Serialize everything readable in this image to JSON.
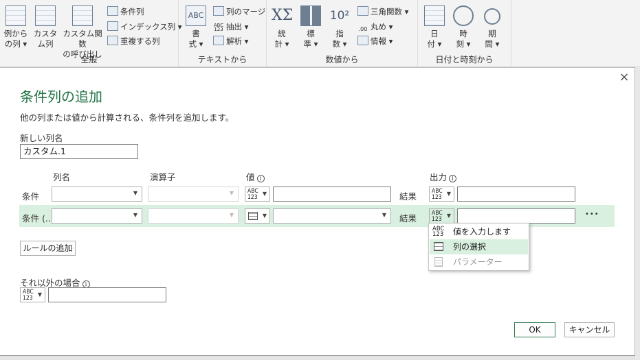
{
  "ribbon": {
    "groups": {
      "general": "全般",
      "text": "テキストから",
      "number": "数値から",
      "datetime": "日付と時刻から"
    },
    "buttons": {
      "from_examples": [
        "例から",
        "の列 ▾"
      ],
      "custom_column": [
        "カスタ",
        "ム列"
      ],
      "invoke_custom_function": [
        "カスタム関数",
        "の呼び出し"
      ],
      "format": [
        "書",
        "式 ▾"
      ],
      "statistics": [
        "統",
        "計 ▾"
      ],
      "standard": [
        "標",
        "準 ▾"
      ],
      "scientific": [
        "指",
        "数 ▾"
      ],
      "date": [
        "日",
        "付 ▾"
      ],
      "time": [
        "時",
        "刻 ▾"
      ],
      "duration": [
        "期",
        "間 ▾"
      ]
    },
    "small": {
      "conditional_column": "条件列",
      "index_column": "インデックス列 ▾",
      "duplicate_column": "重複する列",
      "merge_columns": "列のマージ",
      "extract": "抽出 ▾",
      "parse": "解析 ▾",
      "trigonometry": "三角関数 ▾",
      "rounding": "丸め ▾",
      "information": "情報 ▾"
    },
    "icon_text": {
      "abc_format": "ABC",
      "abc123": "ABC\n123",
      "sigma": "XΣ",
      "ten_squared": "10²",
      "round_digits": ".00"
    }
  },
  "dialog": {
    "title": "条件列の追加",
    "description": "他の列または値から計算される、条件列を追加します。",
    "new_column_label": "新しい列名",
    "new_column_value": "カスタム.1",
    "headers": {
      "column_name": "列名",
      "operator": "演算子",
      "value": "値",
      "output": "出力"
    },
    "rows": [
      {
        "label": "条件",
        "result_label": "結果"
      },
      {
        "label": "条件 (...",
        "result_label": "結果"
      }
    ],
    "type_icon": "ABC\n123",
    "more": "•••",
    "add_rule": "ルールの追加",
    "else_label": "それ以外の場合",
    "ok": "OK",
    "cancel": "キャンセル",
    "close": "×",
    "info_glyph": "i"
  },
  "menu": {
    "items": [
      {
        "label": "値を入力します",
        "icon": "abc123-icon",
        "icon_text": "ABC\n123"
      },
      {
        "label": "列の選択",
        "icon": "table-icon"
      },
      {
        "label": "パラメーター",
        "icon": "parameter-icon"
      }
    ]
  },
  "colors": {
    "accent_green": "#217346",
    "highlight_green": "#d9efdf"
  }
}
